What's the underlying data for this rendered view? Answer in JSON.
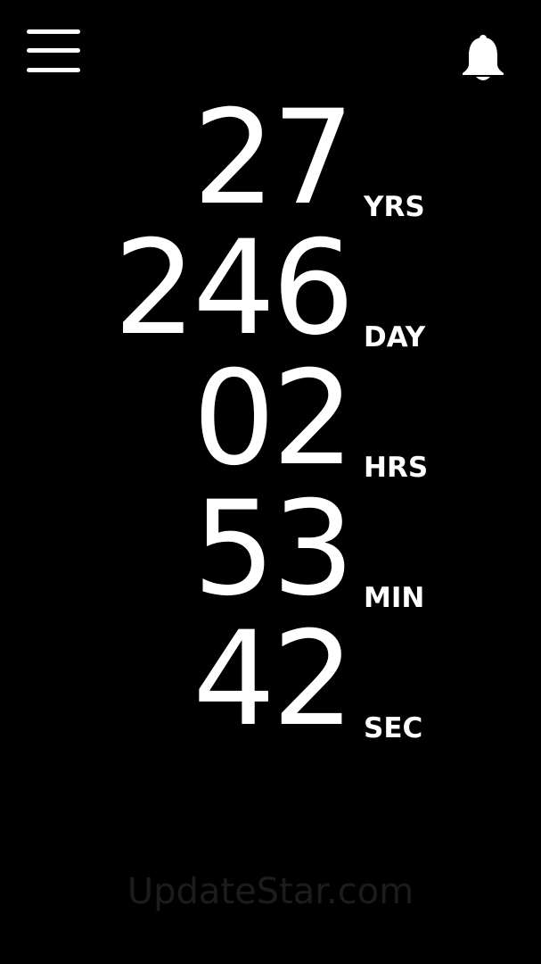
{
  "header": {
    "menu_icon": "hamburger-menu-icon",
    "bell_icon": "bell-icon"
  },
  "counter": [
    {
      "value": "27",
      "unit": "YRS"
    },
    {
      "value": "246",
      "unit": "DAY"
    },
    {
      "value": "02",
      "unit": "HRS"
    },
    {
      "value": "53",
      "unit": "MIN"
    },
    {
      "value": "42",
      "unit": "SEC"
    }
  ],
  "watermark": "UpdateStar.com",
  "colors": {
    "background": "#000000",
    "foreground": "#ffffff",
    "watermark": "#1c1c1c"
  }
}
